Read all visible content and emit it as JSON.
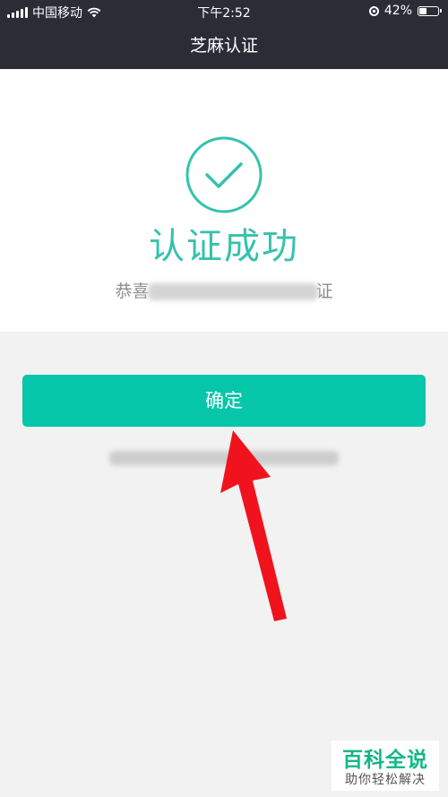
{
  "status_bar": {
    "carrier": "中国移动",
    "time": "下午2:52",
    "battery": "42%",
    "battery_level": 0.42
  },
  "nav": {
    "title": "芝麻认证"
  },
  "result": {
    "title": "认证成功",
    "subtitle_prefix": "恭喜",
    "subtitle_suffix": "证"
  },
  "actions": {
    "confirm_label": "确定"
  },
  "watermark": {
    "main": "百科全说",
    "sub": "助你轻松解决"
  },
  "colors": {
    "accent": "#05c6a8",
    "title": "#35c2ad",
    "nav_background": "#2b2c36",
    "arrow": "#f0131e"
  },
  "icons": [
    "signal-icon",
    "wifi-icon",
    "orientation-lock-icon",
    "battery-icon",
    "check-circle-icon",
    "red-arrow-annotation"
  ]
}
